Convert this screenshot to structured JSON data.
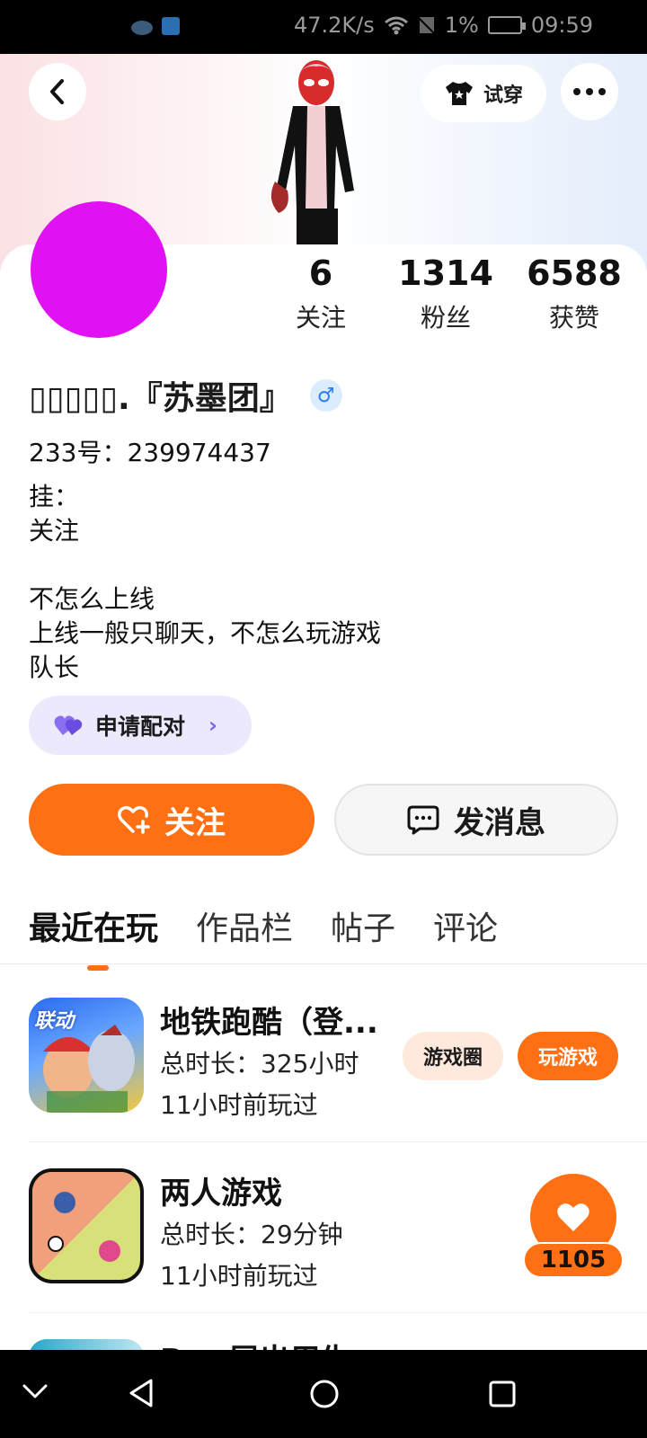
{
  "status_bar": {
    "speed": "47.2K/s",
    "battery_percent": "1%",
    "time": "09:59"
  },
  "header": {
    "try_on_label": "试穿"
  },
  "stats": [
    {
      "value": "6",
      "label": "关注"
    },
    {
      "value": "1314",
      "label": "粉丝"
    },
    {
      "value": "6588",
      "label": "获赞"
    }
  ],
  "profile": {
    "name": "▯▯▯▯▯.『苏墨团』",
    "gender_symbol": "♂",
    "uid": "233号：239974437",
    "bio_lines": [
      "挂：",
      "关注",
      "",
      "不怎么上线",
      "上线一般只聊天，不怎么玩游戏",
      "队长"
    ],
    "match_label": "申请配对"
  },
  "actions": {
    "follow_label": "关注",
    "message_label": "发消息"
  },
  "tabs": [
    "最近在玩",
    "作品栏",
    "帖子",
    "评论"
  ],
  "games": [
    {
      "title": "地铁跑酷（登...",
      "duration": "总时长：325小时",
      "last_played": "11小时前玩过",
      "circle_label": "游戏圈",
      "play_label": "玩游戏",
      "icon_badge": "联动"
    },
    {
      "title": "两人游戏",
      "duration": "总时长：29分钟",
      "last_played": "11小时前玩过"
    }
  ],
  "like_badge": {
    "count": "1105"
  },
  "next_title_peek": "B··· 层出用生",
  "colors": {
    "accent": "#ff7014",
    "avatar": "#e012f3",
    "match_bg": "#ece9fd"
  }
}
